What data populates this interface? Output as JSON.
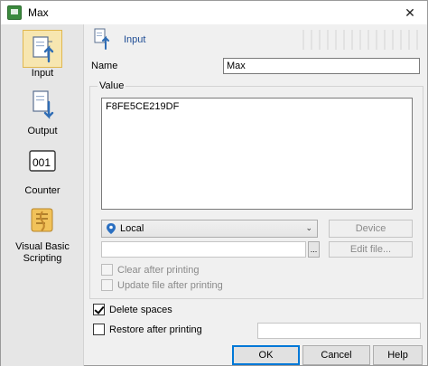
{
  "window": {
    "title": "Max",
    "close_symbol": "✕"
  },
  "sidebar": {
    "items": [
      {
        "label": "Input",
        "icon": "input-icon",
        "selected": true
      },
      {
        "label": "Output",
        "icon": "output-icon"
      },
      {
        "label": "Counter",
        "icon": "counter-icon",
        "glyph": "001"
      },
      {
        "label": "Visual Basic Scripting",
        "label_line1": "Visual Basic",
        "label_line2": "Scripting",
        "icon": "vb-scripting-icon"
      }
    ]
  },
  "header": {
    "title": "Input",
    "icon": "input-icon"
  },
  "name": {
    "label": "Name",
    "value": "Max"
  },
  "value_group": {
    "legend": "Value",
    "text": "F8FE5CE219DF",
    "location": {
      "selected": "Local",
      "icon": "location-pin-icon",
      "chevron": "⌄"
    },
    "device_button": "Device",
    "browse_button": "...",
    "edit_file_button": "Edit file...",
    "clear_after_printing": {
      "label": "Clear after printing",
      "checked": false
    },
    "update_file_after_printing": {
      "label": "Update file after printing",
      "checked": false
    }
  },
  "delete_spaces": {
    "label": "Delete spaces",
    "checked": true
  },
  "restore_after_printing": {
    "label": "Restore after printing",
    "checked": false
  },
  "buttons": {
    "ok": "OK",
    "cancel": "Cancel",
    "help": "Help"
  },
  "colors": {
    "accent": "#0078d7",
    "selected_bg": "#f7e6b0",
    "header_text": "#1e4c94"
  }
}
